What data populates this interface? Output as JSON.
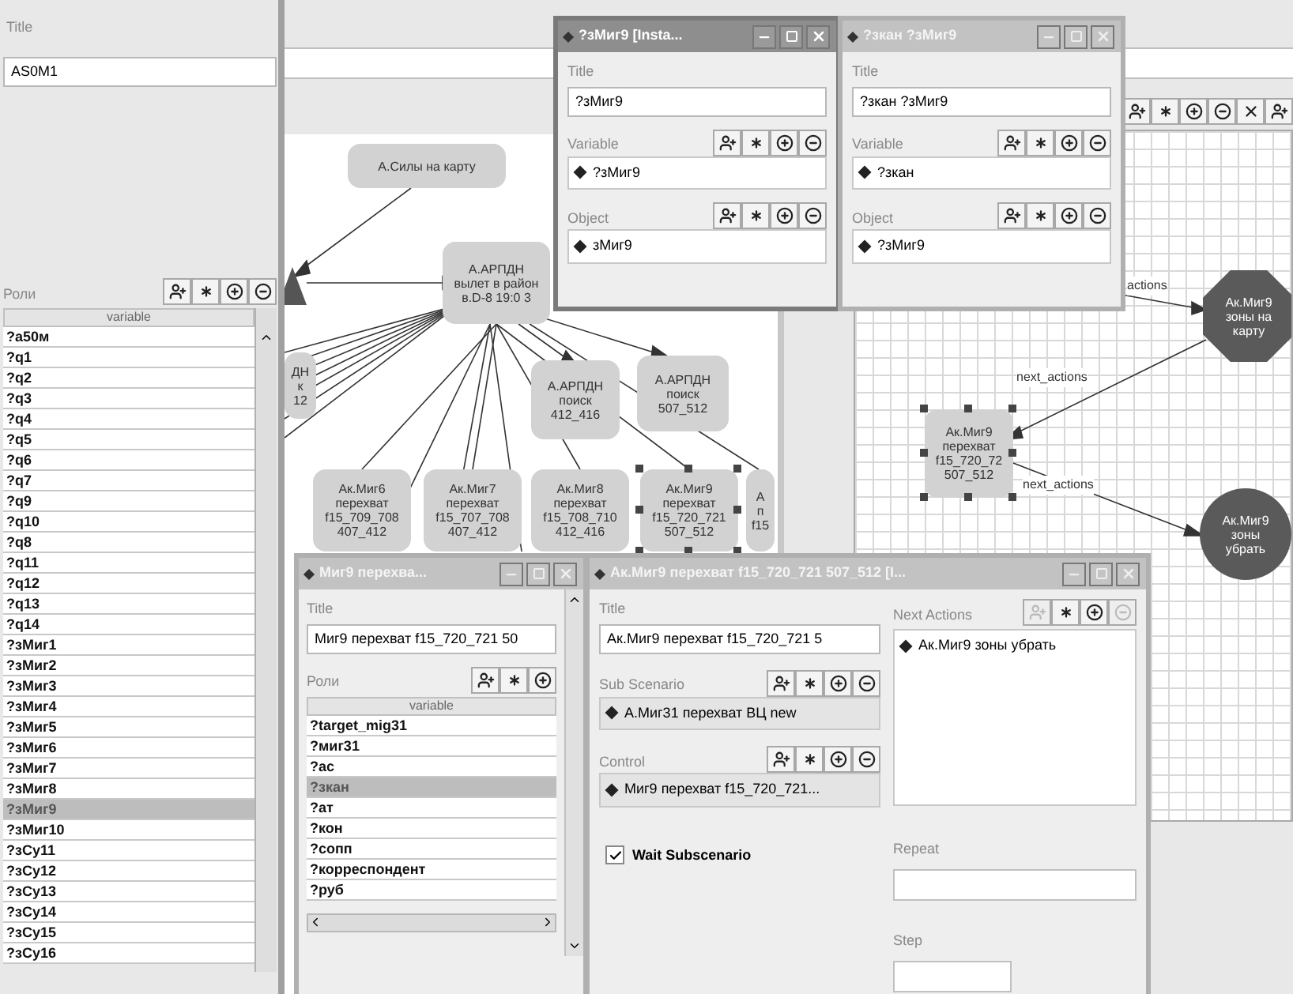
{
  "main_panel": {
    "title_label": "Title",
    "title_value": "AS0M1",
    "roles_label": "Роли",
    "roles_toolbar": [
      {
        "kind": "add_person",
        "disabled": false
      },
      {
        "kind": "asterisk",
        "disabled": false
      },
      {
        "kind": "add_node",
        "disabled": false
      },
      {
        "kind": "remove_node",
        "disabled": false
      }
    ],
    "table": {
      "columns": [
        "variable"
      ],
      "rows": [
        {
          "variable": "?а50м",
          "selected": false
        },
        {
          "variable": "?q1",
          "selected": false
        },
        {
          "variable": "?q2",
          "selected": false
        },
        {
          "variable": "?q3",
          "selected": false
        },
        {
          "variable": "?q4",
          "selected": false
        },
        {
          "variable": "?q5",
          "selected": false
        },
        {
          "variable": "?q6",
          "selected": false
        },
        {
          "variable": "?q7",
          "selected": false
        },
        {
          "variable": "?q9",
          "selected": false
        },
        {
          "variable": "?q10",
          "selected": false
        },
        {
          "variable": "?q8",
          "selected": false
        },
        {
          "variable": "?q11",
          "selected": false
        },
        {
          "variable": "?q12",
          "selected": false
        },
        {
          "variable": "?q13",
          "selected": false
        },
        {
          "variable": "?q14",
          "selected": false
        },
        {
          "variable": "?зМиг1",
          "selected": false
        },
        {
          "variable": "?зМиг2",
          "selected": false
        },
        {
          "variable": "?зМиг3",
          "selected": false
        },
        {
          "variable": "?зМиг4",
          "selected": false
        },
        {
          "variable": "?зМиг5",
          "selected": false
        },
        {
          "variable": "?зМиг6",
          "selected": false
        },
        {
          "variable": "?зМиг7",
          "selected": false
        },
        {
          "variable": "?зМиг8",
          "selected": false
        },
        {
          "variable": "?зМиг9",
          "selected": true
        },
        {
          "variable": "?зМиг10",
          "selected": false
        },
        {
          "variable": "?зСу11",
          "selected": false
        },
        {
          "variable": "?зСу12",
          "selected": false
        },
        {
          "variable": "?зСу13",
          "selected": false
        },
        {
          "variable": "?зСу14",
          "selected": false
        },
        {
          "variable": "?зСу15",
          "selected": false
        },
        {
          "variable": "?зСу16",
          "selected": false
        }
      ]
    }
  },
  "canvas": {
    "nodes": [
      {
        "label": "А.Силы на карту",
        "kind": "rounded",
        "selected": false
      },
      {
        "label": "А.АРПДН\nвылет в район\nв.D-8 19:0 3",
        "kind": "rounded",
        "selected": false
      },
      {
        "label": "ДН\nк\n12",
        "kind": "rounded",
        "selected": false
      },
      {
        "label": "А.АРПДН\nпоиск\n412_416",
        "kind": "rounded",
        "selected": false
      },
      {
        "label": "А.АРПДН\nпоиск\n507_512",
        "kind": "rounded",
        "selected": false
      },
      {
        "label": "Ак.Миг6\nперехват\nf15_709_708\n407_412",
        "kind": "rounded",
        "selected": false
      },
      {
        "label": "Ак.Миг7\nперехват\nf15_707_708\n407_412",
        "kind": "rounded",
        "selected": false
      },
      {
        "label": "Ак.Миг8\nперехват\nf15_708_710\n412_416",
        "kind": "rounded",
        "selected": false
      },
      {
        "label": "Ак.Миг9\nперехват\nf15_720_721\n507_512",
        "kind": "rounded",
        "selected": true
      },
      {
        "label": "А\nп\nf15",
        "kind": "rounded",
        "selected": false
      }
    ]
  },
  "grid_canvas": {
    "toolbar": [
      {
        "kind": "add_person",
        "disabled": false
      },
      {
        "kind": "asterisk",
        "disabled": false
      },
      {
        "kind": "add_node",
        "disabled": false
      },
      {
        "kind": "remove_node",
        "disabled": false
      },
      {
        "kind": "delete",
        "disabled": false
      },
      {
        "kind": "add_person",
        "disabled": false
      }
    ],
    "nodes": [
      {
        "label": "Ак.Миг9\nзоны на\nкарту",
        "kind": "octagon",
        "selected": false
      },
      {
        "label": "Ак.Миг9\nперехват\nf15_720_72\n507_512",
        "kind": "rounded",
        "selected": true
      },
      {
        "label": "Ак.Миг9\nзоны\nубрать",
        "kind": "circle",
        "selected": false
      }
    ],
    "edges": [
      {
        "label": "actions"
      },
      {
        "label": "next_actions"
      },
      {
        "label": "next_actions"
      }
    ]
  },
  "windows": [
    {
      "kind": "instance",
      "title": "?зМиг9  [Insta...",
      "active": true,
      "title_label": "Title",
      "title_value": "?зМиг9",
      "sections": [
        {
          "label": "Variable",
          "toolbar": [
            {
              "kind": "add_person",
              "disabled": false
            },
            {
              "kind": "asterisk",
              "disabled": false
            },
            {
              "kind": "add_node",
              "disabled": false
            },
            {
              "kind": "remove_node",
              "disabled": false
            }
          ],
          "items": [
            "?зМиг9"
          ]
        },
        {
          "label": "Object",
          "toolbar": [
            {
              "kind": "add_person",
              "disabled": false
            },
            {
              "kind": "asterisk",
              "disabled": false
            },
            {
              "kind": "add_node",
              "disabled": false
            },
            {
              "kind": "remove_node",
              "disabled": false
            }
          ],
          "items": [
            "зМиг9"
          ]
        }
      ]
    },
    {
      "kind": "instance",
      "title": "?зкан ?зМиг9",
      "active": false,
      "title_label": "Title",
      "title_value": "?зкан ?зМиг9",
      "sections": [
        {
          "label": "Variable",
          "toolbar": [
            {
              "kind": "add_person",
              "disabled": false
            },
            {
              "kind": "asterisk",
              "disabled": false
            },
            {
              "kind": "add_node",
              "disabled": false
            },
            {
              "kind": "remove_node",
              "disabled": false
            }
          ],
          "items": [
            "?зкан"
          ]
        },
        {
          "label": "Object",
          "toolbar": [
            {
              "kind": "add_person",
              "disabled": false
            },
            {
              "kind": "asterisk",
              "disabled": false
            },
            {
              "kind": "add_node",
              "disabled": false
            },
            {
              "kind": "remove_node",
              "disabled": false
            }
          ],
          "items": [
            "?зМиг9"
          ]
        }
      ]
    },
    {
      "kind": "roles",
      "title": "Миг9 перехва...",
      "active": false,
      "title_label": "Title",
      "title_value": "Миг9 перехват f15_720_721 50",
      "roles_label": "Роли",
      "toolbar": [
        {
          "kind": "add_person",
          "disabled": false
        },
        {
          "kind": "asterisk",
          "disabled": false
        },
        {
          "kind": "add_node",
          "disabled": false
        }
      ],
      "table": {
        "columns": [
          "variable"
        ],
        "rows": [
          {
            "variable": "?target_mig31",
            "selected": false
          },
          {
            "variable": "?миг31",
            "selected": false
          },
          {
            "variable": "?ас",
            "selected": false
          },
          {
            "variable": "?зкан",
            "selected": true
          },
          {
            "variable": "?ат",
            "selected": false
          },
          {
            "variable": "?кон",
            "selected": false
          },
          {
            "variable": "?сопп",
            "selected": false
          },
          {
            "variable": "?корреспондент",
            "selected": false
          },
          {
            "variable": "?руб",
            "selected": false
          }
        ]
      }
    },
    {
      "kind": "scenario",
      "title": "Ак.Миг9 перехват f15_720_721 507_512 [I...",
      "active": false,
      "title_label": "Title",
      "title_value": "Ак.Миг9 перехват f15_720_721 5",
      "sub_scenario": {
        "label": "Sub Scenario",
        "toolbar": [
          {
            "kind": "add_person",
            "disabled": false
          },
          {
            "kind": "asterisk",
            "disabled": false
          },
          {
            "kind": "add_node",
            "disabled": false
          },
          {
            "kind": "remove_node",
            "disabled": false
          }
        ],
        "items": [
          "А.Миг31 перехват ВЦ new"
        ]
      },
      "control": {
        "label": "Control",
        "toolbar": [
          {
            "kind": "add_person",
            "disabled": false
          },
          {
            "kind": "asterisk",
            "disabled": false
          },
          {
            "kind": "add_node",
            "disabled": false
          },
          {
            "kind": "remove_node",
            "disabled": false
          }
        ],
        "items": [
          "Миг9 перехват f15_720_721..."
        ]
      },
      "wait": {
        "label": "Wait Subscenario",
        "checked": true
      },
      "next_actions": {
        "label": "Next Actions",
        "toolbar": [
          {
            "kind": "add_person",
            "disabled": true
          },
          {
            "kind": "asterisk",
            "disabled": false
          },
          {
            "kind": "add_node",
            "disabled": false
          },
          {
            "kind": "remove_node",
            "disabled": true
          }
        ],
        "items": [
          "Ак.Миг9 зоны убрать"
        ]
      },
      "repeat": {
        "label": "Repeat"
      },
      "step": {
        "label": "Step"
      }
    }
  ]
}
